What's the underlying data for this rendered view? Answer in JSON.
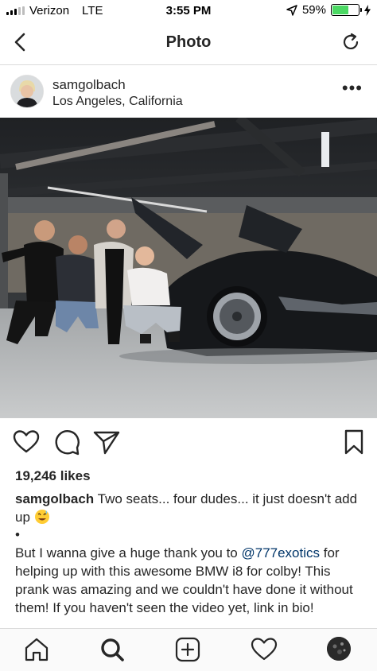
{
  "status_bar": {
    "carrier": "Verizon",
    "network": "LTE",
    "time": "3:55 PM",
    "battery_percent": "59%",
    "battery_level": 0.59
  },
  "nav": {
    "title": "Photo",
    "back_icon": "chevron-left-icon",
    "refresh_icon": "refresh-icon"
  },
  "post": {
    "username": "samgolbach",
    "location": "Los Angeles, California",
    "more_icon": "more-icon",
    "more_text": "•••",
    "likes": "19,246 likes",
    "caption": {
      "username": "samgolbach",
      "text": "Two seats... four dudes... it just doesn't add up",
      "dot": "•",
      "para_before": "But I wanna give a huge thank you to ",
      "mention": "@777exotics",
      "para_after": " for helping up with this awesome BMW i8 for colby! This prank was amazing and we couldn't have done it without them! If you haven't seen the video yet, link in bio!"
    }
  },
  "actions": {
    "like_icon": "heart-icon",
    "comment_icon": "comment-icon",
    "share_icon": "send-icon",
    "save_icon": "bookmark-icon"
  },
  "tabbar": {
    "items": [
      "home-icon",
      "search-icon",
      "add-icon",
      "activity-icon",
      "profile-avatar"
    ]
  },
  "colors": {
    "text": "#262626",
    "mention": "#003569",
    "battery": "#4cd964",
    "divider": "#dbdbdb"
  }
}
